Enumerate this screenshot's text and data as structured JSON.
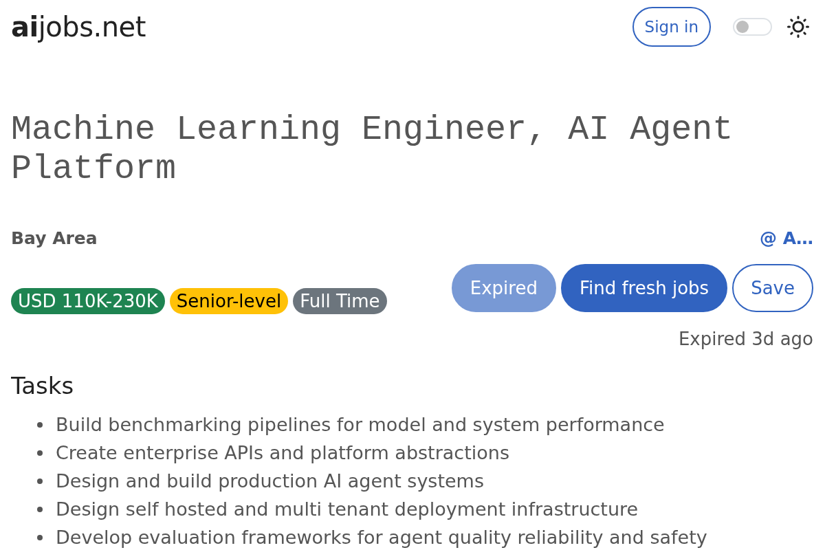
{
  "header": {
    "logo": "**ai**jobs.net",
    "sign_in": "Sign in",
    "theme_toggle": {
      "on": false
    }
  },
  "job": {
    "title": "Machine Learning Engineer, AI Agent Platform",
    "location": "Bay Area",
    "company": "@ A…",
    "tags": [
      {
        "label": "USD 110K-230K",
        "color": "#1e8451"
      },
      {
        "label": "Senior-level",
        "color": "#ffc107"
      },
      {
        "label": "Full Time",
        "color": "#6c757d"
      }
    ],
    "actions": [
      {
        "label": "Expired",
        "kind": "primary",
        "disabled": true
      },
      {
        "label": "Find fresh jobs",
        "kind": "primary",
        "disabled": false
      },
      {
        "label": "Save",
        "kind": "outline",
        "disabled": false
      }
    ],
    "expiry_note": "Expired 3d ago"
  },
  "sections": [
    {
      "heading": "Tasks",
      "items": [
        "Build benchmarking pipelines for model and system performance",
        "Create enterprise APIs and platform abstractions",
        "Design and build production AI agent systems",
        "Design self hosted and multi tenant deployment infrastructure",
        "Develop evaluation frameworks for agent quality reliability and safety"
      ]
    }
  ]
}
